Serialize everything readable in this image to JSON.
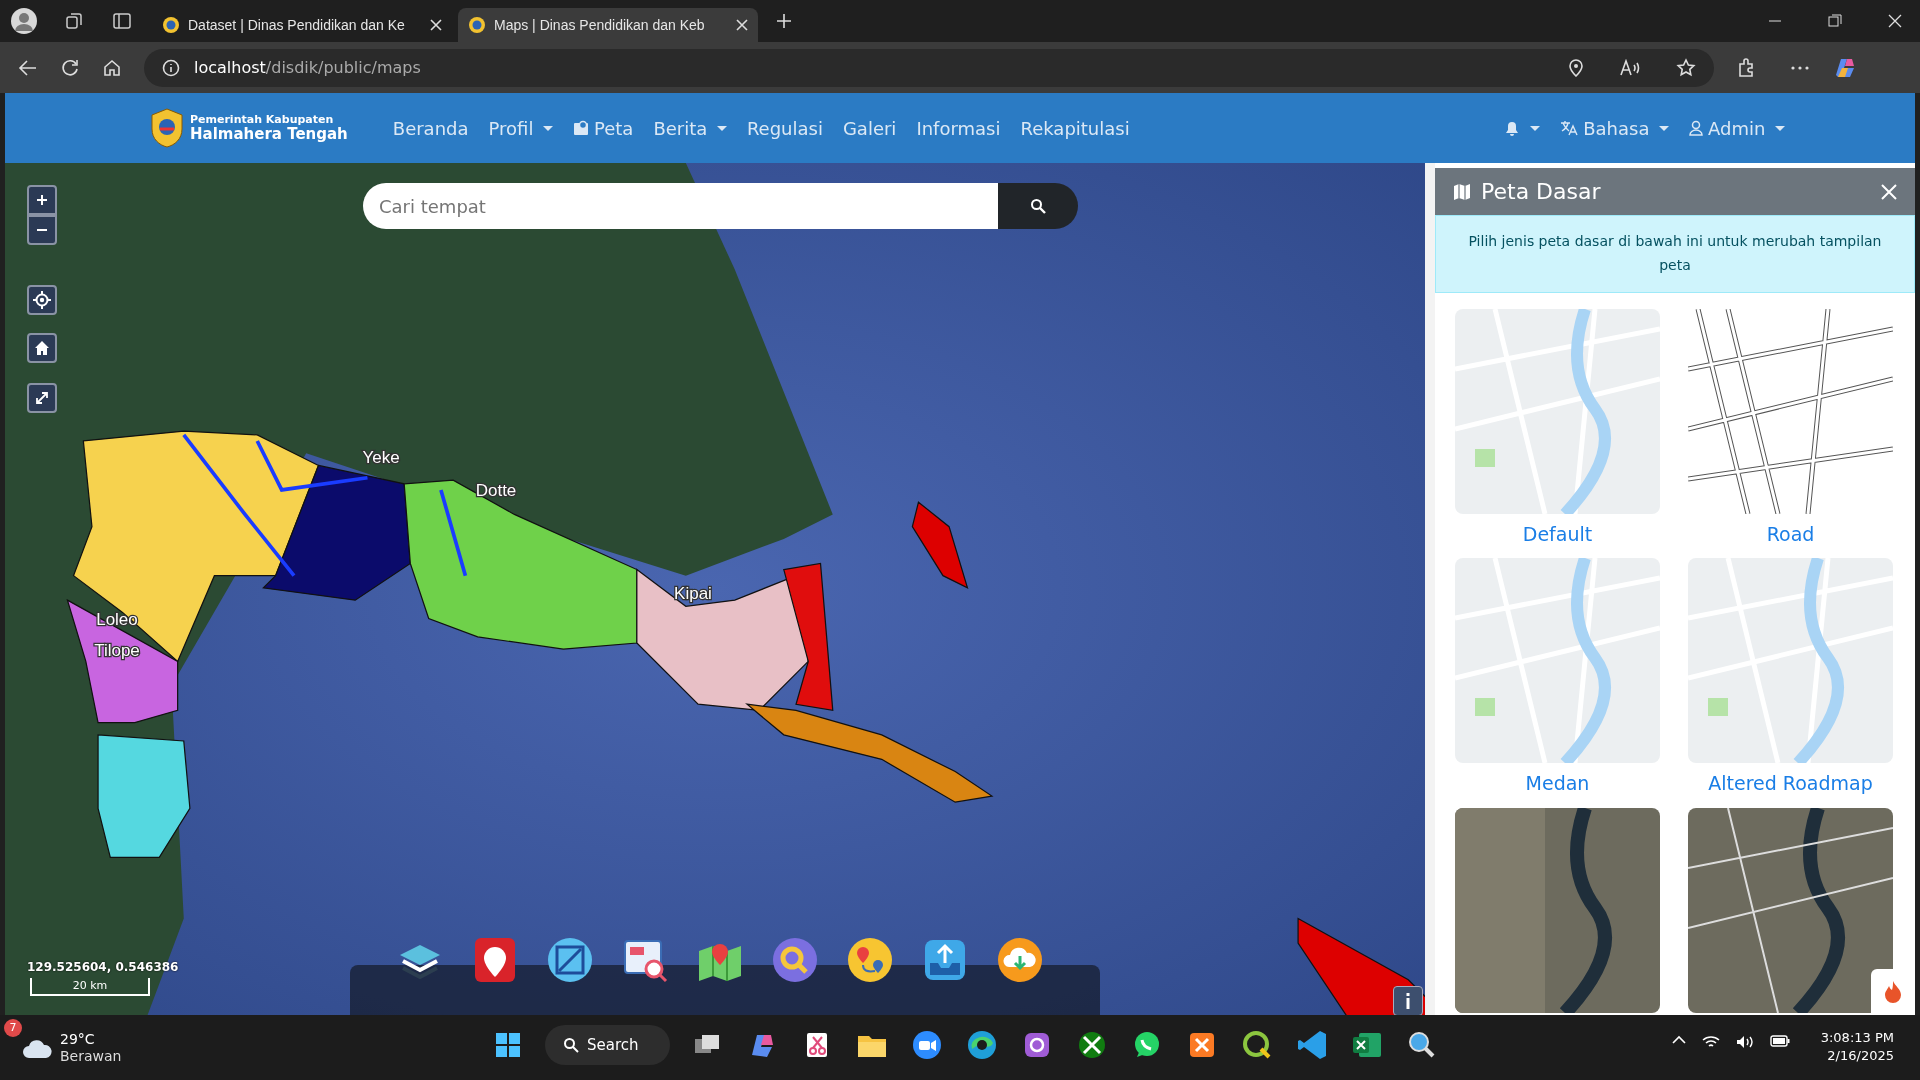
{
  "browser": {
    "tabs": [
      {
        "title": "Dataset | Dinas Pendidikan dan Ke",
        "selected": false
      },
      {
        "title": "Maps | Dinas Pendidikan dan Keb",
        "selected": true
      }
    ],
    "address": {
      "host": "localhost",
      "path": "/disdik/public/maps"
    }
  },
  "navbar": {
    "brand": {
      "line1": "Pemerintah Kabupaten",
      "line2": "Halmahera Tengah"
    },
    "menu": [
      {
        "label": "Beranda",
        "kind": "link"
      },
      {
        "label": "Profil",
        "kind": "dropdown"
      },
      {
        "label": "Peta",
        "kind": "icon-link"
      },
      {
        "label": "Berita",
        "kind": "dropdown"
      },
      {
        "label": "Regulasi",
        "kind": "link"
      },
      {
        "label": "Galeri",
        "kind": "link"
      },
      {
        "label": "Informasi",
        "kind": "link"
      },
      {
        "label": "Rekapitulasi",
        "kind": "link"
      }
    ],
    "right_menu": [
      {
        "kind": "bell"
      },
      {
        "label": "Bahasa",
        "kind": "language"
      },
      {
        "label": "Admin",
        "kind": "user"
      }
    ]
  },
  "map": {
    "search": {
      "placeholder": "Cari tempat"
    },
    "region_labels": [
      {
        "text": "Yeke"
      },
      {
        "text": "Dotte"
      },
      {
        "text": "Loleo"
      },
      {
        "text": "Tilope"
      },
      {
        "text": "Kipai"
      }
    ],
    "coordinates": "129.525604, 0.546386",
    "scale": "20 km"
  },
  "panel": {
    "title": "Peta Dasar",
    "hint": "Pilih jenis peta dasar di bawah ini untuk merubah tampilan peta",
    "basemaps": [
      {
        "label": "Default",
        "kind": "street"
      },
      {
        "label": "Road",
        "kind": "road"
      },
      {
        "label": "Medan",
        "kind": "street"
      },
      {
        "label": "Altered Roadmap",
        "kind": "street"
      },
      {
        "kind": "satellite"
      },
      {
        "kind": "hybrid"
      }
    ]
  },
  "taskbar": {
    "weather": {
      "badge": "7",
      "temperature": "29°C",
      "condition": "Berawan"
    },
    "search": "Search",
    "time": "3:08:13 PM",
    "date": "2/16/2025"
  }
}
